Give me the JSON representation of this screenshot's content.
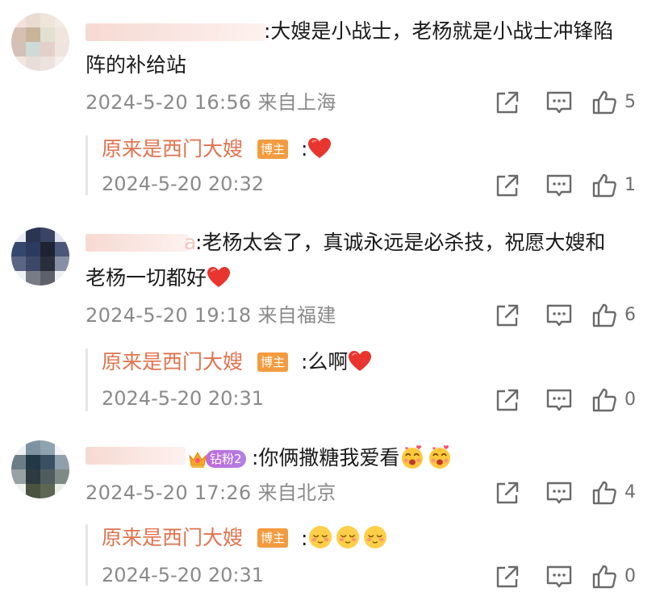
{
  "comments": [
    {
      "text_line1": ":大嫂是小战士，老杨就是小战士冲锋陷",
      "text_line2": "阵的补给站",
      "time": "2024-5-20 16:56",
      "location": "来自上海",
      "likes": "5",
      "reply": {
        "name": "原来是西门大嫂",
        "badge": "博主",
        "text": ":",
        "emojis": [
          "red-heart"
        ],
        "time": "2024-5-20 20:32",
        "likes": "1"
      }
    },
    {
      "name_tail": "a",
      "text_line1": ":老杨太会了，真诚永远是必杀技，祝愿大嫂和",
      "text_line2": "老杨一切都好",
      "emojis": [
        "red-heart"
      ],
      "time": "2024-5-20 19:18",
      "location": "来自福建",
      "likes": "6",
      "reply": {
        "name": "原来是西门大嫂",
        "badge": "博主",
        "text": ":么啊",
        "emojis": [
          "red-heart"
        ],
        "time": "2024-5-20 20:31",
        "likes": "0"
      }
    },
    {
      "fan_badge": "钻粉2",
      "text_line1": ":你俩撒糖我爱看",
      "emojis": [
        "love-face",
        "love-face"
      ],
      "time": "2024-5-20 17:26",
      "location": "来自北京",
      "likes": "4",
      "reply": {
        "name": "原来是西门大嫂",
        "badge": "博主",
        "text": ":",
        "emojis": [
          "shy-face",
          "shy-face",
          "shy-face"
        ],
        "time": "2024-5-20 20:31",
        "likes": "0"
      }
    }
  ],
  "icons": {
    "share": "share-icon",
    "comment": "comment-icon",
    "like": "like-icon"
  },
  "colors": {
    "reply_name": "#e0734e",
    "badge_bg": "#f39c3f",
    "meta_text": "#8a8a8a"
  }
}
